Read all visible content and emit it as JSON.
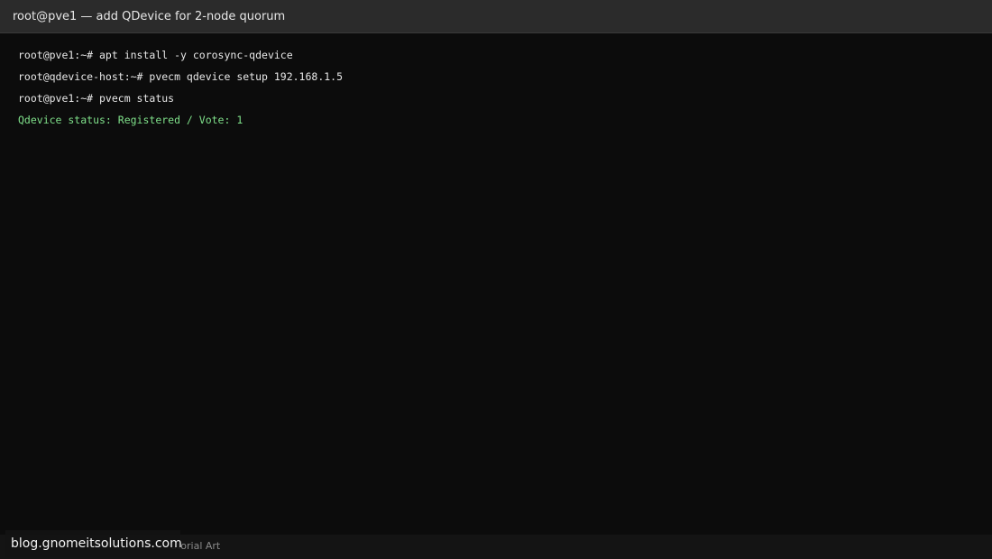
{
  "window": {
    "title": "root@pve1 — add QDevice for 2-node quorum"
  },
  "terminal": {
    "lines": [
      {
        "text": "root@pve1:~# apt install -y corosync-qdevice",
        "type": "command"
      },
      {
        "text": "root@qdevice-host:~# pvecm qdevice setup 192.168.1.5",
        "type": "command"
      },
      {
        "text": "root@pve1:~# pvecm status",
        "type": "command"
      },
      {
        "text": "Qdevice status: Registered / Vote: 1",
        "type": "output"
      }
    ]
  },
  "footer": {
    "caption": "utorial Art"
  },
  "watermark": {
    "text": "blog.gnomeitsolutions.com"
  },
  "colors": {
    "background": "#0c0c0c",
    "titlebar": "#2b2b2b",
    "command_text": "#e8e8e8",
    "output_text": "#7fe08a"
  }
}
